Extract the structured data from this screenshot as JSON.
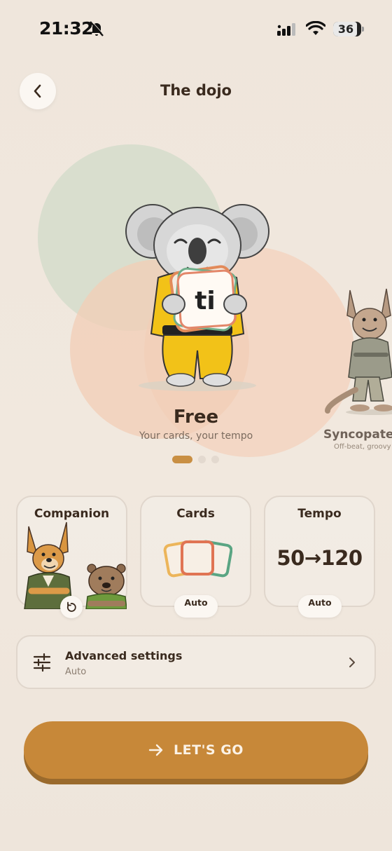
{
  "status_bar": {
    "time": "21:32",
    "battery": "36"
  },
  "header": {
    "title": "The dojo"
  },
  "carousel": {
    "current": {
      "title": "Free",
      "subtitle": "Your cards, your tempo",
      "card_glyph": "ti"
    },
    "next": {
      "title": "Syncopated",
      "subtitle": "Off-beat, groovy"
    },
    "page_count": 3,
    "active_page": 1
  },
  "options": {
    "companion": {
      "label": "Companion"
    },
    "cards": {
      "label": "Cards",
      "value": "Auto"
    },
    "tempo": {
      "label": "Tempo",
      "value_text": "50→120",
      "value": "Auto"
    }
  },
  "advanced": {
    "title": "Advanced settings",
    "subtitle": "Auto"
  },
  "primary_button": {
    "label": "LET'S GO"
  },
  "colors": {
    "accent": "#c78839",
    "text": "#3a2a1e",
    "background": "#f0e7dd"
  }
}
